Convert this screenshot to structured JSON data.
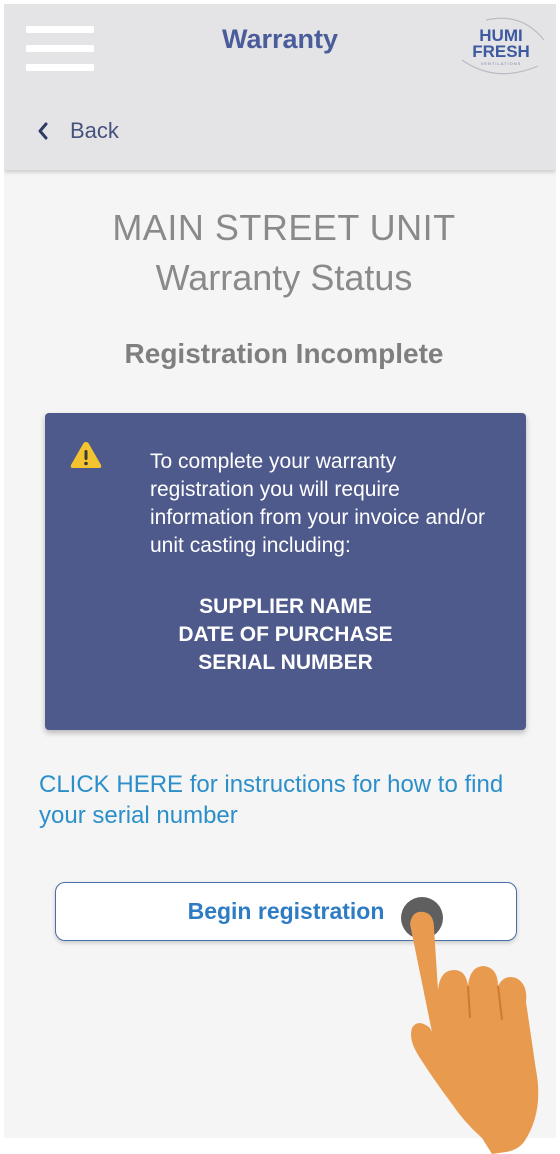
{
  "header": {
    "title": "Warranty",
    "back_label": "Back",
    "logo_line1": "HUMI",
    "logo_line2": "FRESH",
    "logo_tagline": "VENTILATIONS"
  },
  "main": {
    "unit_name": "MAIN STREET UNIT",
    "status_title": "Warranty Status",
    "status_value": "Registration Incomplete"
  },
  "info_card": {
    "icon": "warning-icon",
    "message": "To complete your warranty registration you will require information from your invoice and/or unit casting including:",
    "requirements": [
      "SUPPLIER NAME",
      "DATE OF PURCHASE",
      "SERIAL NUMBER"
    ]
  },
  "help_link": {
    "text": "CLICK HERE for instructions for how to find your serial number"
  },
  "begin_button": {
    "label": "Begin registration"
  },
  "colors": {
    "brand": "#4a5d9a",
    "card_bg": "#4f5a8c",
    "warning": "#f4c430",
    "link": "#2c8fc9",
    "button_text": "#2d7cc4",
    "hand": "#e89a4e"
  }
}
